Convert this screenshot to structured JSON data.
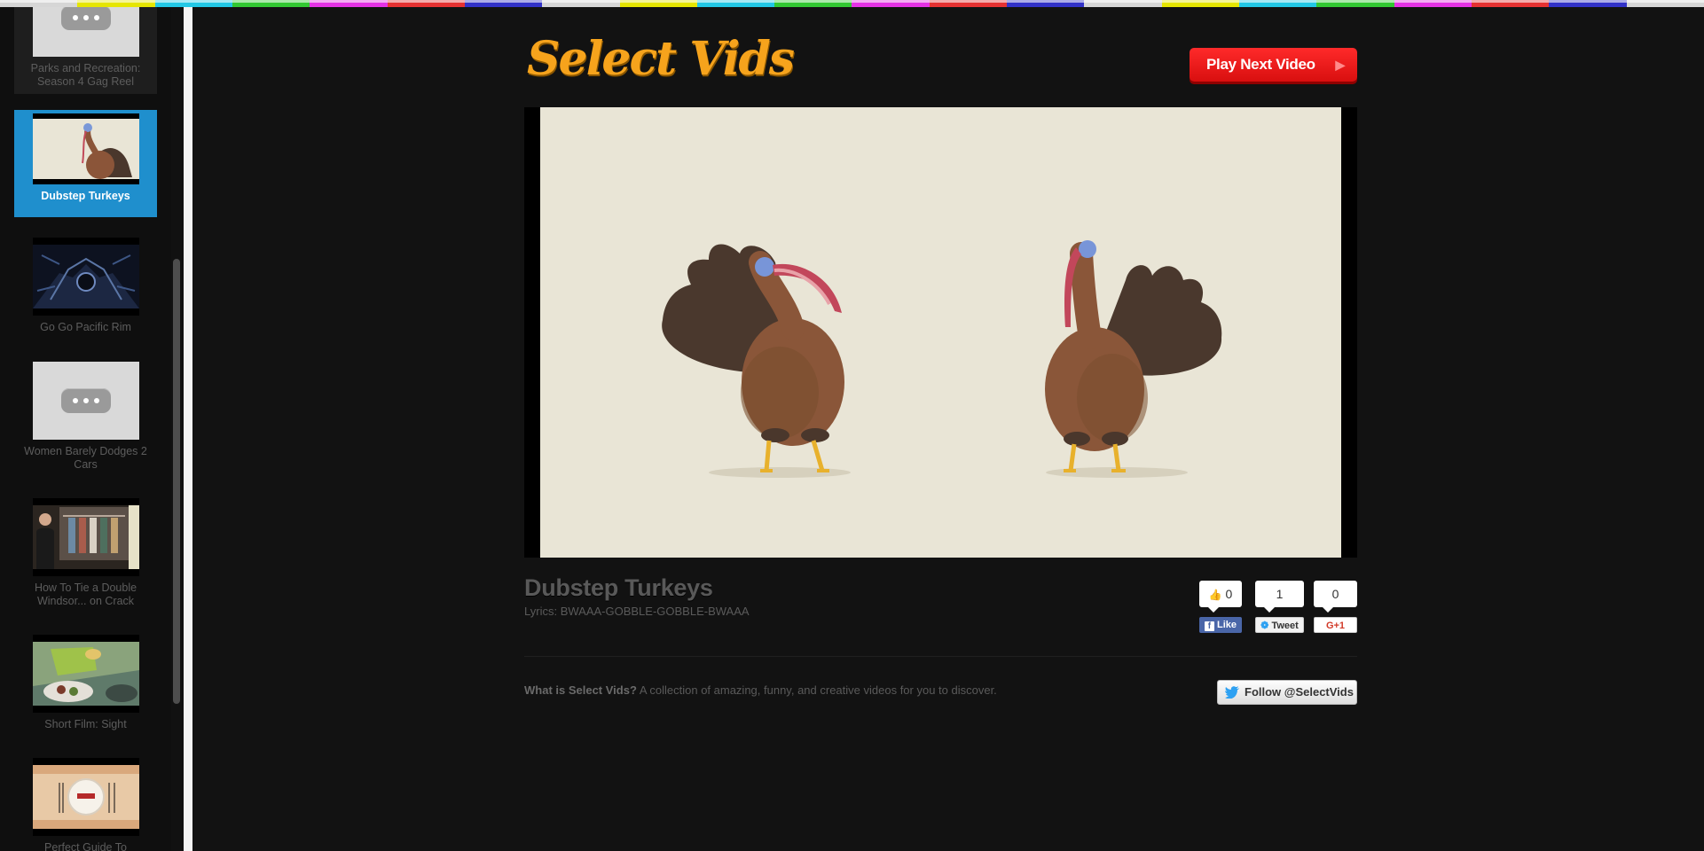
{
  "app": {
    "logo_text": "Select Vids",
    "play_next_label": "Play Next Video",
    "accent": "#f6a31c",
    "play_next_color": "#f01818",
    "active_color": "#1f8fcd",
    "top_strip_colors": [
      "#d6d6d6",
      "#e6e600",
      "#22c8e6",
      "#32c832",
      "#e632e6",
      "#e63232",
      "#3232c8",
      "#d6d6d6",
      "#e6e600",
      "#22c8e6",
      "#32c832",
      "#e632e6",
      "#e63232",
      "#3232c8",
      "#d6d6d6",
      "#e6e600",
      "#22c8e6",
      "#32c832",
      "#e632e6",
      "#e63232",
      "#3232c8",
      "#d6d6d6"
    ]
  },
  "sidebar": {
    "items": [
      {
        "label": "Parks and Recreation: Season 4 Gag Reel",
        "thumb": "placeholder"
      },
      {
        "label": "Dubstep Turkeys",
        "thumb": "turkey",
        "active": true
      },
      {
        "label": "Go Go Pacific Rim",
        "thumb": "dark-scene"
      },
      {
        "label": "Women Barely Dodges 2 Cars",
        "thumb": "placeholder"
      },
      {
        "label": "How To Tie a Double Windsor... on Crack",
        "thumb": "closet"
      },
      {
        "label": "Short Film: Sight",
        "thumb": "food-table"
      },
      {
        "label": "Perfect Guide To",
        "thumb": "plate-setting"
      }
    ]
  },
  "video": {
    "title": "Dubstep Turkeys",
    "lyrics": "Lyrics: BWAAA-GOBBLE-GOBBLE-BWAAA"
  },
  "social": {
    "like_count": "0",
    "like_label": "Like",
    "tweet_count": "1",
    "tweet_label": "Tweet",
    "plus_count": "0",
    "plus_label": "+1",
    "plus_prefix": "G"
  },
  "footer": {
    "about_bold": "What is Select Vids?",
    "about_text": " A collection of amazing, funny, and creative videos for you to discover.",
    "follow_label": "Follow @SelectVids"
  }
}
